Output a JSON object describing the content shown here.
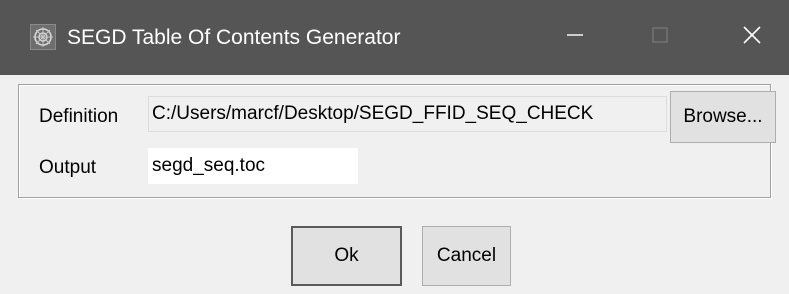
{
  "window": {
    "title": "SEGD Table Of Contents Generator",
    "icon": "app-logo-icon",
    "controls": {
      "minimize": "minimize-icon",
      "maximize": "maximize-icon",
      "close": "close-icon"
    },
    "titlebar_color": "#555555"
  },
  "form": {
    "definition_label": "Definition",
    "definition_value": "C:/Users/marcf/Desktop/SEGD_FFID_SEQ_CHECK",
    "browse_label": "Browse...",
    "output_label": "Output",
    "output_value": "segd_seq.toc"
  },
  "buttons": {
    "ok_label": "Ok",
    "cancel_label": "Cancel"
  }
}
